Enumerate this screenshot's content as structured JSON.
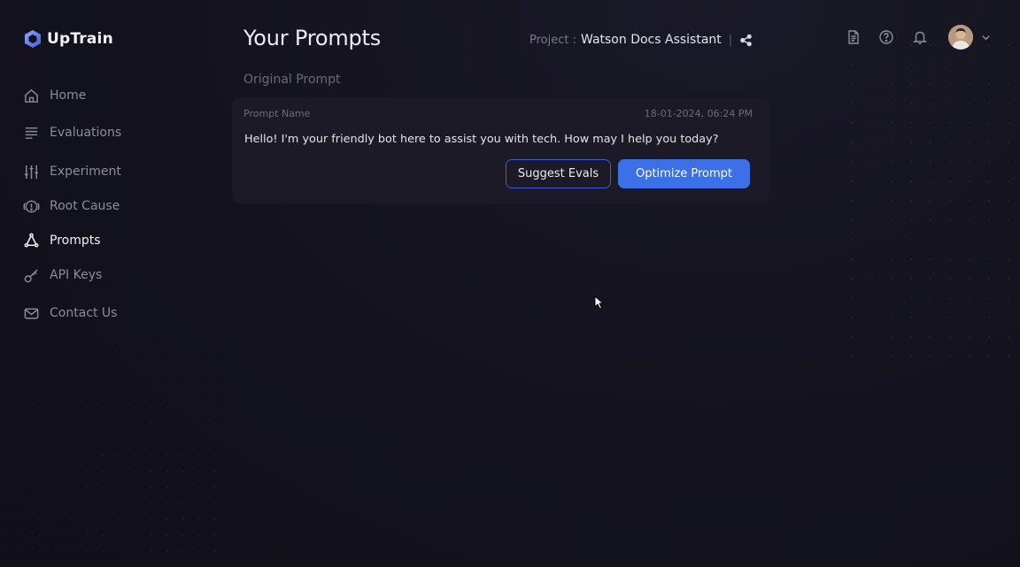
{
  "app": {
    "brand": "UpTrain"
  },
  "sidebar": {
    "items": [
      {
        "label": "Home",
        "icon": "home-icon",
        "active": false
      },
      {
        "label": "Evaluations",
        "icon": "list-icon",
        "active": false
      },
      {
        "label": "Experiment",
        "icon": "sliders-icon",
        "active": false
      },
      {
        "label": "Root Cause",
        "icon": "alert-icon",
        "active": false
      },
      {
        "label": "Prompts",
        "icon": "prompts-icon",
        "active": true
      },
      {
        "label": "API Keys",
        "icon": "key-icon",
        "active": false
      },
      {
        "label": "Contact Us",
        "icon": "mail-icon",
        "active": false
      }
    ]
  },
  "header": {
    "title": "Your Prompts",
    "project_label": "Project :",
    "project_name": "Watson Docs Assistant",
    "separator": "|"
  },
  "main": {
    "section_title": "Original Prompt",
    "prompt_card": {
      "name_label": "Prompt Name",
      "timestamp": "18-01-2024, 06:24 PM",
      "text": "Hello! I'm your friendly bot here to assist you with tech. How may I help you today?",
      "suggest_label": "Suggest Evals",
      "optimize_label": "Optimize Prompt"
    }
  },
  "colors": {
    "background": "#13121d",
    "card": "#1b1a26",
    "accent": "#3d6fe6",
    "accent_border": "#3c5dd6"
  }
}
